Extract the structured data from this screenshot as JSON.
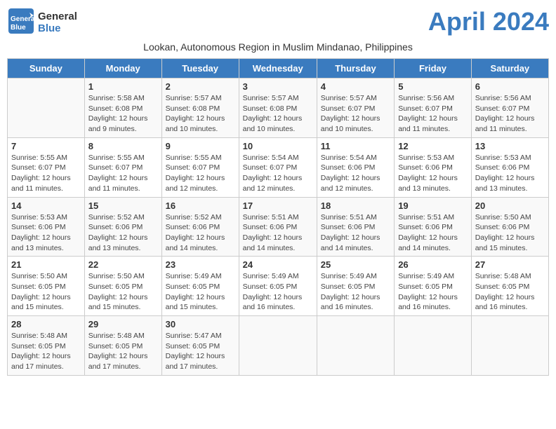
{
  "header": {
    "logo_general": "General",
    "logo_blue": "Blue",
    "month_title": "April 2024",
    "subtitle": "Lookan, Autonomous Region in Muslim Mindanao, Philippines"
  },
  "days_of_week": [
    "Sunday",
    "Monday",
    "Tuesday",
    "Wednesday",
    "Thursday",
    "Friday",
    "Saturday"
  ],
  "weeks": [
    [
      {
        "day": "",
        "info": ""
      },
      {
        "day": "1",
        "info": "Sunrise: 5:58 AM\nSunset: 6:08 PM\nDaylight: 12 hours\nand 9 minutes."
      },
      {
        "day": "2",
        "info": "Sunrise: 5:57 AM\nSunset: 6:08 PM\nDaylight: 12 hours\nand 10 minutes."
      },
      {
        "day": "3",
        "info": "Sunrise: 5:57 AM\nSunset: 6:08 PM\nDaylight: 12 hours\nand 10 minutes."
      },
      {
        "day": "4",
        "info": "Sunrise: 5:57 AM\nSunset: 6:07 PM\nDaylight: 12 hours\nand 10 minutes."
      },
      {
        "day": "5",
        "info": "Sunrise: 5:56 AM\nSunset: 6:07 PM\nDaylight: 12 hours\nand 11 minutes."
      },
      {
        "day": "6",
        "info": "Sunrise: 5:56 AM\nSunset: 6:07 PM\nDaylight: 12 hours\nand 11 minutes."
      }
    ],
    [
      {
        "day": "7",
        "info": "Sunrise: 5:55 AM\nSunset: 6:07 PM\nDaylight: 12 hours\nand 11 minutes."
      },
      {
        "day": "8",
        "info": "Sunrise: 5:55 AM\nSunset: 6:07 PM\nDaylight: 12 hours\nand 11 minutes."
      },
      {
        "day": "9",
        "info": "Sunrise: 5:55 AM\nSunset: 6:07 PM\nDaylight: 12 hours\nand 12 minutes."
      },
      {
        "day": "10",
        "info": "Sunrise: 5:54 AM\nSunset: 6:07 PM\nDaylight: 12 hours\nand 12 minutes."
      },
      {
        "day": "11",
        "info": "Sunrise: 5:54 AM\nSunset: 6:06 PM\nDaylight: 12 hours\nand 12 minutes."
      },
      {
        "day": "12",
        "info": "Sunrise: 5:53 AM\nSunset: 6:06 PM\nDaylight: 12 hours\nand 13 minutes."
      },
      {
        "day": "13",
        "info": "Sunrise: 5:53 AM\nSunset: 6:06 PM\nDaylight: 12 hours\nand 13 minutes."
      }
    ],
    [
      {
        "day": "14",
        "info": "Sunrise: 5:53 AM\nSunset: 6:06 PM\nDaylight: 12 hours\nand 13 minutes."
      },
      {
        "day": "15",
        "info": "Sunrise: 5:52 AM\nSunset: 6:06 PM\nDaylight: 12 hours\nand 13 minutes."
      },
      {
        "day": "16",
        "info": "Sunrise: 5:52 AM\nSunset: 6:06 PM\nDaylight: 12 hours\nand 14 minutes."
      },
      {
        "day": "17",
        "info": "Sunrise: 5:51 AM\nSunset: 6:06 PM\nDaylight: 12 hours\nand 14 minutes."
      },
      {
        "day": "18",
        "info": "Sunrise: 5:51 AM\nSunset: 6:06 PM\nDaylight: 12 hours\nand 14 minutes."
      },
      {
        "day": "19",
        "info": "Sunrise: 5:51 AM\nSunset: 6:06 PM\nDaylight: 12 hours\nand 14 minutes."
      },
      {
        "day": "20",
        "info": "Sunrise: 5:50 AM\nSunset: 6:06 PM\nDaylight: 12 hours\nand 15 minutes."
      }
    ],
    [
      {
        "day": "21",
        "info": "Sunrise: 5:50 AM\nSunset: 6:05 PM\nDaylight: 12 hours\nand 15 minutes."
      },
      {
        "day": "22",
        "info": "Sunrise: 5:50 AM\nSunset: 6:05 PM\nDaylight: 12 hours\nand 15 minutes."
      },
      {
        "day": "23",
        "info": "Sunrise: 5:49 AM\nSunset: 6:05 PM\nDaylight: 12 hours\nand 15 minutes."
      },
      {
        "day": "24",
        "info": "Sunrise: 5:49 AM\nSunset: 6:05 PM\nDaylight: 12 hours\nand 16 minutes."
      },
      {
        "day": "25",
        "info": "Sunrise: 5:49 AM\nSunset: 6:05 PM\nDaylight: 12 hours\nand 16 minutes."
      },
      {
        "day": "26",
        "info": "Sunrise: 5:49 AM\nSunset: 6:05 PM\nDaylight: 12 hours\nand 16 minutes."
      },
      {
        "day": "27",
        "info": "Sunrise: 5:48 AM\nSunset: 6:05 PM\nDaylight: 12 hours\nand 16 minutes."
      }
    ],
    [
      {
        "day": "28",
        "info": "Sunrise: 5:48 AM\nSunset: 6:05 PM\nDaylight: 12 hours\nand 17 minutes."
      },
      {
        "day": "29",
        "info": "Sunrise: 5:48 AM\nSunset: 6:05 PM\nDaylight: 12 hours\nand 17 minutes."
      },
      {
        "day": "30",
        "info": "Sunrise: 5:47 AM\nSunset: 6:05 PM\nDaylight: 12 hours\nand 17 minutes."
      },
      {
        "day": "",
        "info": ""
      },
      {
        "day": "",
        "info": ""
      },
      {
        "day": "",
        "info": ""
      },
      {
        "day": "",
        "info": ""
      }
    ]
  ]
}
